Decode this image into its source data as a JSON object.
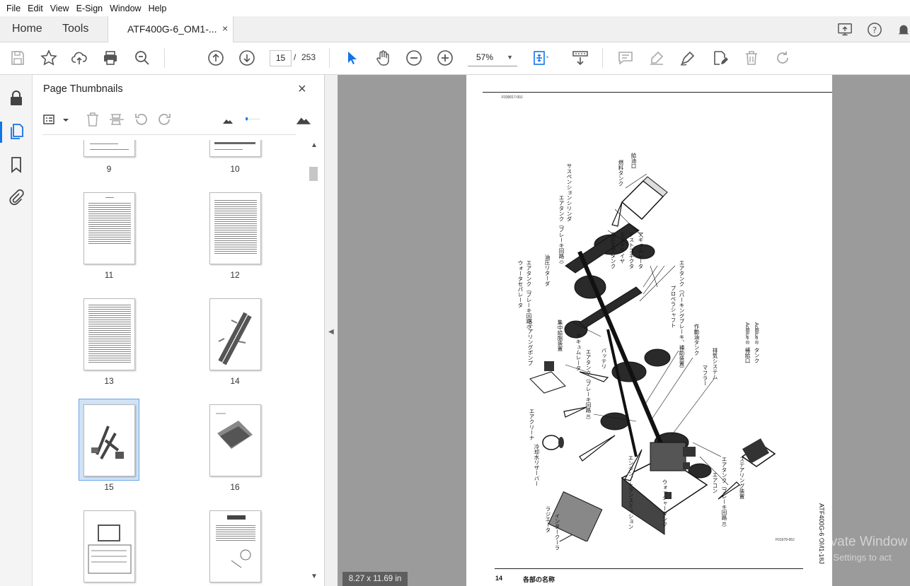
{
  "menu": [
    "File",
    "Edit",
    "View",
    "E-Sign",
    "Window",
    "Help"
  ],
  "tabs": {
    "home": "Home",
    "tools": "Tools",
    "document": "ATF400G-6_OM1-...",
    "close": "×"
  },
  "toolbar": {
    "current_page": "15",
    "separator": "/",
    "total_pages": "253",
    "zoom": "57%"
  },
  "panel": {
    "title": "Page Thumbnails",
    "close": "×",
    "thumbnails": [
      {
        "label": "9"
      },
      {
        "label": "10"
      },
      {
        "label": "11"
      },
      {
        "label": "12"
      },
      {
        "label": "13"
      },
      {
        "label": "14"
      },
      {
        "label": "15",
        "selected": true
      },
      {
        "label": "16"
      },
      {
        "label": ""
      },
      {
        "label": ""
      }
    ]
  },
  "page": {
    "code": "F030017-00J",
    "number": "14",
    "section": "各部の名称",
    "figure_code": "F01679-00J",
    "side_title": "ATF400G-6 OM1-18J",
    "labels": {
      "fuel_tank": "燃料タンク",
      "fuel_inlet": "給油口",
      "suspension_cylinder": "サスペンションシリンダ",
      "air_tank_brake1": "エアタンク（ブレーキ回路 I）",
      "high_pressure_air_tank": "高圧エアタンク",
      "air_dryer": "エアドライヤ",
      "test_connector": "テストコネクタ",
      "accumulator_top": "アキュムレータ",
      "hydraulic_retarder": "油圧リターダ",
      "water_separator": "ウォータセパレータ",
      "air_tank_brake1b": "エアタンク（ブレーキ回路 I）",
      "propeller_shaft": "プロペラシャフト",
      "air_tank_parking": "エアタンク（パーキングブレーキ、補助装置）",
      "hydraulic_oil_tank": "作動油タンク",
      "central_lube": "集中給脂装置",
      "accumulator_mid": "アキュムレータ",
      "steering_pump": "ステアリングポンプ",
      "air_tank_brake2": "エアタンク（ブレーキ回路 II）",
      "battery": "バッテリ",
      "muffler": "マフラー",
      "exhaust_system": "排気システム",
      "adblue_inlet": "AdBlue® 補給口",
      "adblue_tank": "AdBlue® タンク",
      "air_cleaner": "エアクリーナ",
      "coolant_reservoir": "冷却水リザーバー",
      "radiator": "ラジエータ",
      "intercooler": "インタークーラ",
      "engine_transmission": "エンジン／トランスミッション",
      "washer_tank": "ウォッシャータンク",
      "aircon": "エアコン",
      "air_tank_brake2b": "エアタンク（ブレーキ回路 II）",
      "steering_valve": "ステアリング装置"
    }
  },
  "status": {
    "page_size": "8.27 x 11.69 in"
  },
  "watermark": {
    "line1": "Activate Window",
    "line2": "Go to Settings to act"
  },
  "colors": {
    "accent": "#1473e6",
    "viewer_bg": "#9b9b9b",
    "selection": "#cfe2f7"
  }
}
